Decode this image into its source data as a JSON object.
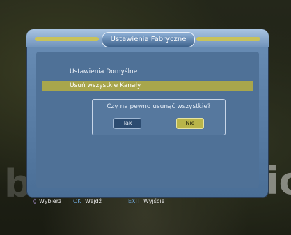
{
  "dialog": {
    "title": "Ustawienia Fabryczne",
    "items": [
      {
        "label": "Ustawienia Domyślne"
      },
      {
        "label": "Usuń wszystkie Kanały"
      }
    ]
  },
  "confirm": {
    "question": "Czy na pewno usunąć wszystkie?",
    "yes_label": "Tak",
    "no_label": "Nie"
  },
  "footer": {
    "select_icon": "◊",
    "select_label": "Wybierz",
    "ok_key": "OK",
    "ok_label": "Wejdź",
    "exit_key": "EXIT",
    "exit_label": "Wyjście"
  },
  "background": {
    "left_glyph": "be",
    "right_glyph": "io"
  },
  "colors": {
    "frame": "#5f83ad",
    "highlight": "#a8a64c",
    "no_button": "#b9b54a",
    "key_text": "#6fa7d8"
  }
}
